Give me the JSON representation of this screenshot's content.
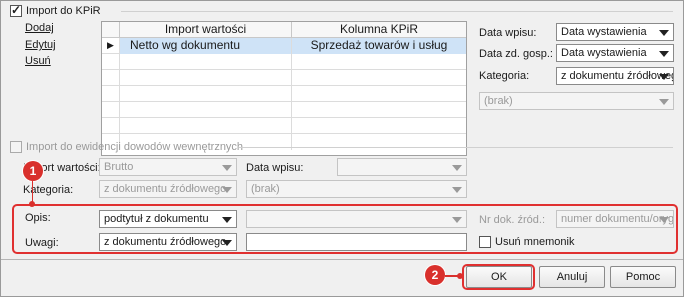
{
  "kpir_section": {
    "checkbox_label": "Import do KPiR",
    "checked": true,
    "actions": [
      "Dodaj",
      "Edytuj",
      "Usuń"
    ],
    "table": {
      "columns": [
        "Import wartości",
        "Kolumna KPiR"
      ],
      "rows": [
        {
          "import_value": "Netto wg dokumentu",
          "kpir_column": "Sprzedaż towarów i usług",
          "marker": "▶"
        }
      ]
    },
    "data_wpisu_label": "Data wpisu:",
    "data_wpisu_value": "Data wystawienia",
    "data_zd_label": "Data zd. gosp.:",
    "data_zd_value": "Data wystawienia",
    "kategoria_label": "Kategoria:",
    "kategoria_value": "z dokumentu źródłowego",
    "brak_value": "(brak)"
  },
  "internal_section": {
    "checkbox_label": "Import do ewidencji dowodów wewnętrznych",
    "checked": false,
    "import_label": "Import wartości:",
    "import_value": "Brutto",
    "data_wpisu_label": "Data wpisu:",
    "data_wpisu_value": "",
    "kategoria_label": "Kategoria:",
    "kategoria_value": "z dokumentu źródłowego",
    "brak_value": "(brak)"
  },
  "opis_section": {
    "opis_label": "Opis:",
    "opis_value": "podtytuł z dokumentu",
    "uwagi_label": "Uwagi:",
    "uwagi_value": "z dokumentu źródłowego",
    "nr_dok_label": "Nr dok. źród.:",
    "nr_dok_value": "numer dokumentu/oryg",
    "usun_mnemonik_label": "Usuń mnemonik"
  },
  "badges": {
    "first": "1",
    "second": "2"
  },
  "footer": {
    "ok": "OK",
    "anuluj": "Anuluj",
    "pomoc": "Pomoc"
  },
  "colors": {
    "accent_red": "#d9302c",
    "selection": "#cfe3f7"
  }
}
